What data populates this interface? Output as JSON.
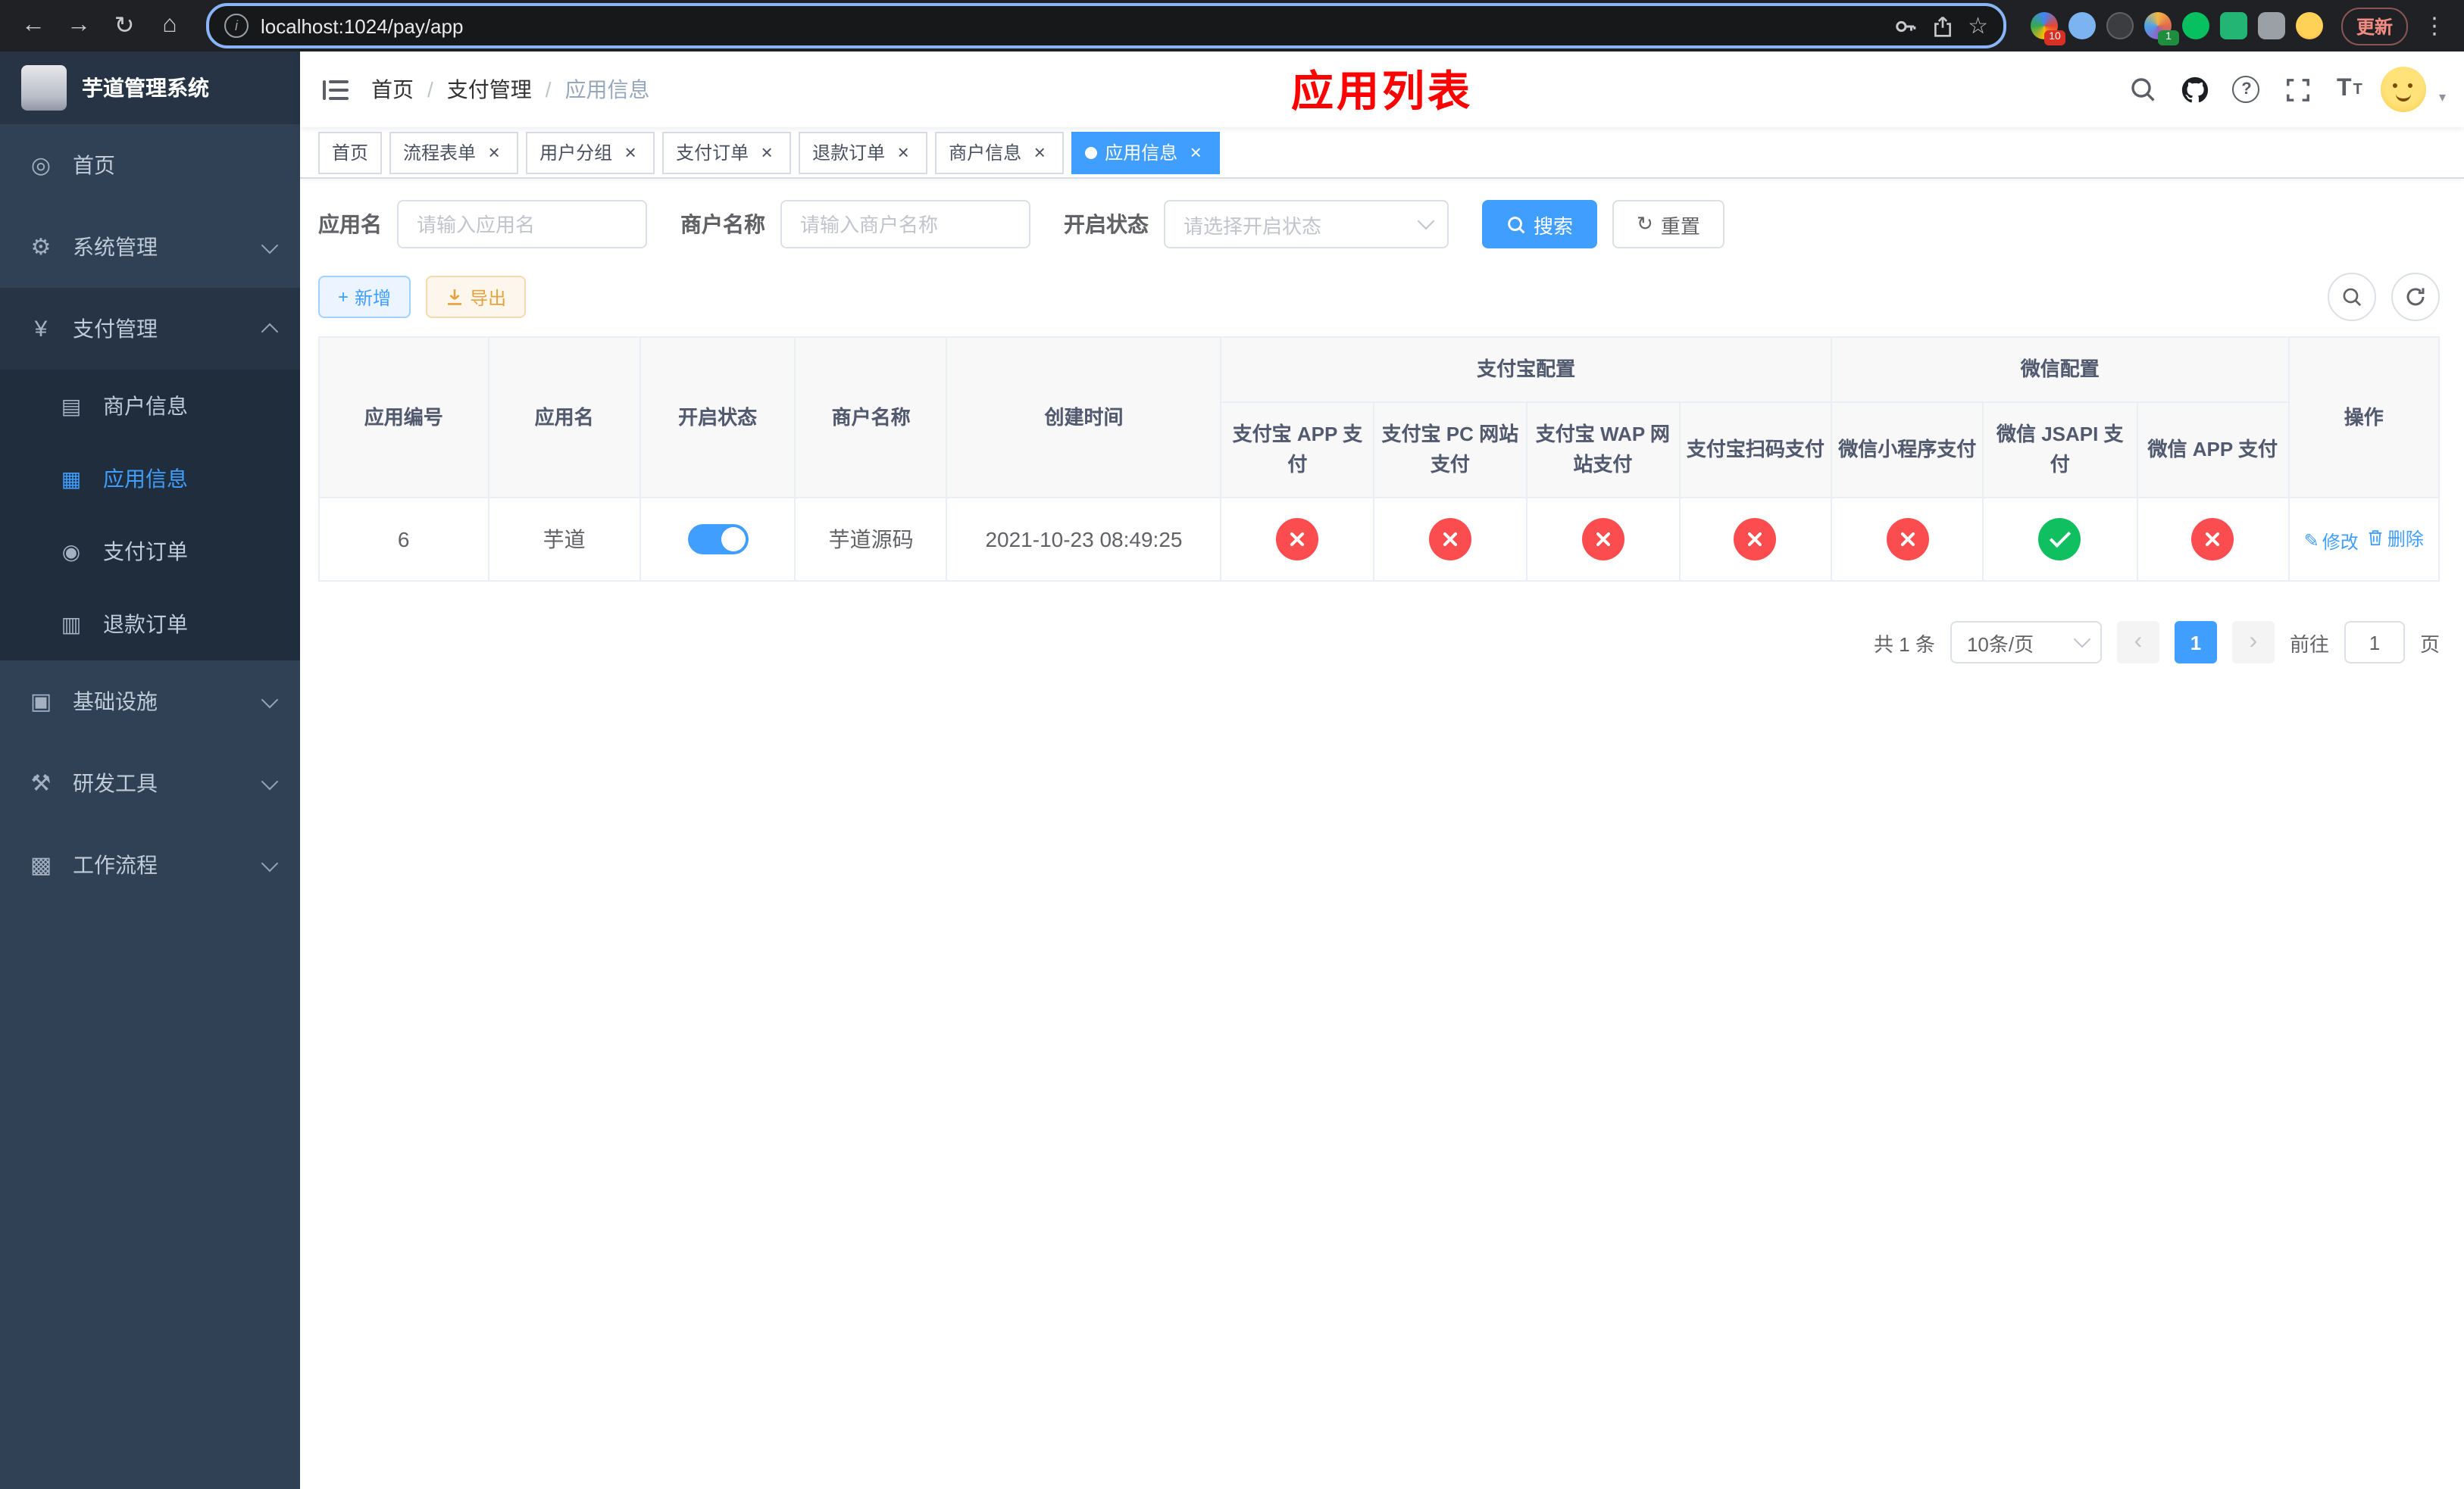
{
  "colors": {
    "accent": "#409eff",
    "danger": "#fb4d4f",
    "success": "#10bf60",
    "warning": "#e6a23c",
    "page_title_red": "#ff0000",
    "sidebar_bg": "#304156",
    "sidebar_sub_bg": "#1f2d3d"
  },
  "icons": {
    "back": "←",
    "forward": "→",
    "reload": "↻",
    "home": "⌂",
    "info": "i",
    "star": "☆",
    "overflow_menu": "⋮",
    "close": "×",
    "question": "?",
    "text_size_big": "T",
    "text_size_small": "T",
    "caret_down": "▾",
    "refresh": "↻",
    "plus": "+",
    "edit_pen": "✎",
    "prev": "‹",
    "next": "›"
  },
  "browser": {
    "url": "localhost:1024/pay/app",
    "update_label": "更新",
    "extensions_badge": "10",
    "profile_badge": "1"
  },
  "sidebar": {
    "title": "芋道管理系统",
    "items": [
      {
        "icon": "◎",
        "label": "首页"
      },
      {
        "icon": "⚙",
        "label": "系统管理"
      },
      {
        "icon": "¥",
        "label": "支付管理"
      },
      {
        "icon": "▣",
        "label": "基础设施"
      },
      {
        "icon": "⚒",
        "label": "研发工具"
      },
      {
        "icon": "▩",
        "label": "工作流程"
      }
    ],
    "sub_items": [
      {
        "icon": "▤",
        "label": "商户信息"
      },
      {
        "icon": "▦",
        "label": "应用信息"
      },
      {
        "icon": "◉",
        "label": "支付订单"
      },
      {
        "icon": "▥",
        "label": "退款订单"
      }
    ]
  },
  "header": {
    "breadcrumb": [
      {
        "label": "首页"
      },
      {
        "label": "支付管理"
      },
      {
        "label": "应用信息"
      }
    ],
    "page_title": "应用列表"
  },
  "tabs": [
    {
      "label": "首页"
    },
    {
      "label": "流程表单"
    },
    {
      "label": "用户分组"
    },
    {
      "label": "支付订单"
    },
    {
      "label": "退款订单"
    },
    {
      "label": "商户信息"
    },
    {
      "label": "应用信息"
    }
  ],
  "filters": {
    "app_name_label": "应用名",
    "app_name_placeholder": "请输入应用名",
    "merchant_label": "商户名称",
    "merchant_placeholder": "请输入商户名称",
    "status_label": "开启状态",
    "status_placeholder": "请选择开启状态",
    "search_label": "搜索",
    "reset_label": "重置"
  },
  "toolbar": {
    "add_label": "新增",
    "export_label": "导出"
  },
  "table": {
    "col_id": "应用编号",
    "col_name": "应用名",
    "col_status": "开启状态",
    "col_merchant": "商户名称",
    "col_created": "创建时间",
    "group_alipay": "支付宝配置",
    "group_wechat": "微信配置",
    "col_alipay_app": "支付宝 APP 支付",
    "col_alipay_pc": "支付宝 PC 网站支付",
    "col_alipay_wap": "支付宝 WAP 网站支付",
    "col_alipay_qr": "支付宝扫码支付",
    "col_wx_mini": "微信小程序支付",
    "col_wx_jsapi": "微信 JSAPI 支付",
    "col_wx_app": "微信 APP 支付",
    "col_action": "操作",
    "rows": [
      {
        "id": "6",
        "name": "芋道",
        "enabled": true,
        "merchant": "芋道源码",
        "created": "2021-10-23 08:49:25",
        "alipay_app": false,
        "alipay_pc": false,
        "alipay_wap": false,
        "alipay_qr": false,
        "wx_mini": false,
        "wx_jsapi": true,
        "wx_app": false,
        "edit_label": "修改",
        "delete_label": "删除"
      }
    ]
  },
  "pagination": {
    "total": "共 1 条",
    "page_size": "10条/页",
    "page": "1",
    "goto_label": "前往",
    "goto_value": "1",
    "unit_label": "页"
  }
}
